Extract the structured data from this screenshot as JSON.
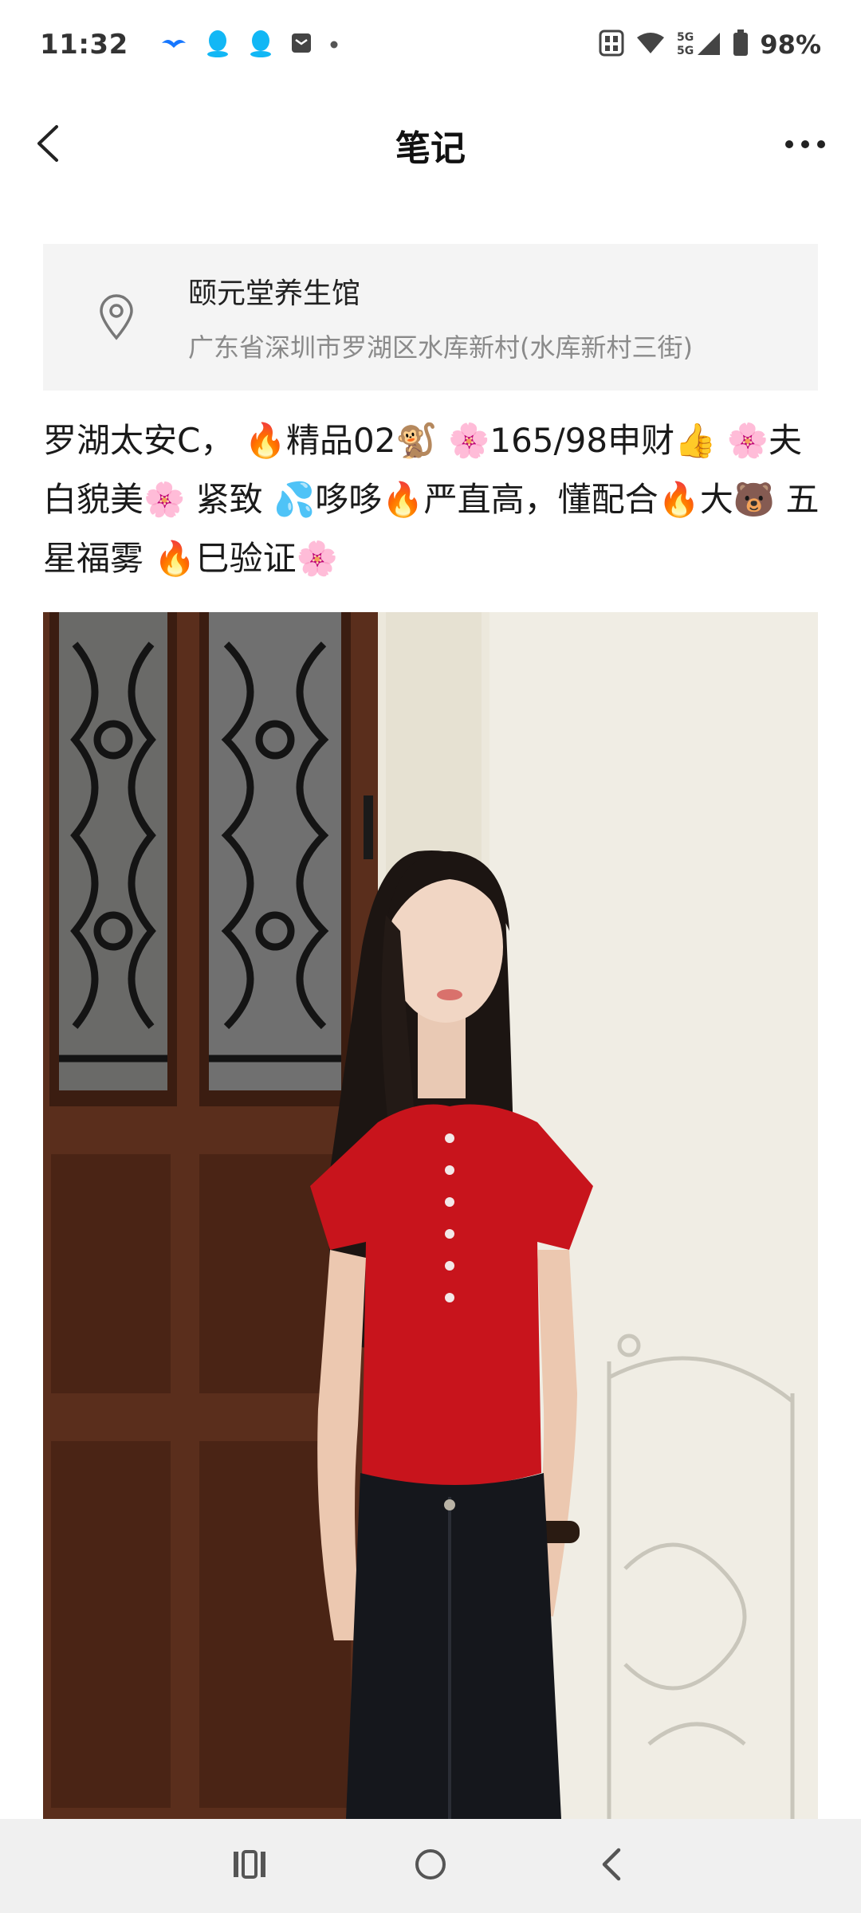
{
  "status_bar": {
    "time": "11:32",
    "battery": "98%",
    "network": "5G",
    "left_icons": [
      "bird-icon",
      "qq-icon",
      "qq-icon",
      "mail-icon",
      "dot-icon"
    ],
    "right_icons": [
      "nfc-icon",
      "wifi-icon",
      "signal-icon",
      "battery-icon"
    ]
  },
  "header": {
    "title": "笔记",
    "back_icon": "back-arrow-icon",
    "more_icon": "more-dots-icon"
  },
  "location": {
    "icon": "location-pin-icon",
    "name": "颐元堂养生馆",
    "address": "广东省深圳市罗湖区水库新村(水库新村三街)"
  },
  "note": {
    "text": "罗湖太安C， 🔥精品02🐒 🌸165/98申财👍 🌸夫白貌美🌸 紧致 💦哆哆🔥严直高，懂配合🔥大🐻 五星福雾 🔥巳验证🌸"
  },
  "photo": {
    "description_icon": "note-photo"
  },
  "nav_bar": {
    "recents_icon": "recents-icon",
    "home_icon": "home-icon",
    "back_icon": "nav-back-icon"
  }
}
